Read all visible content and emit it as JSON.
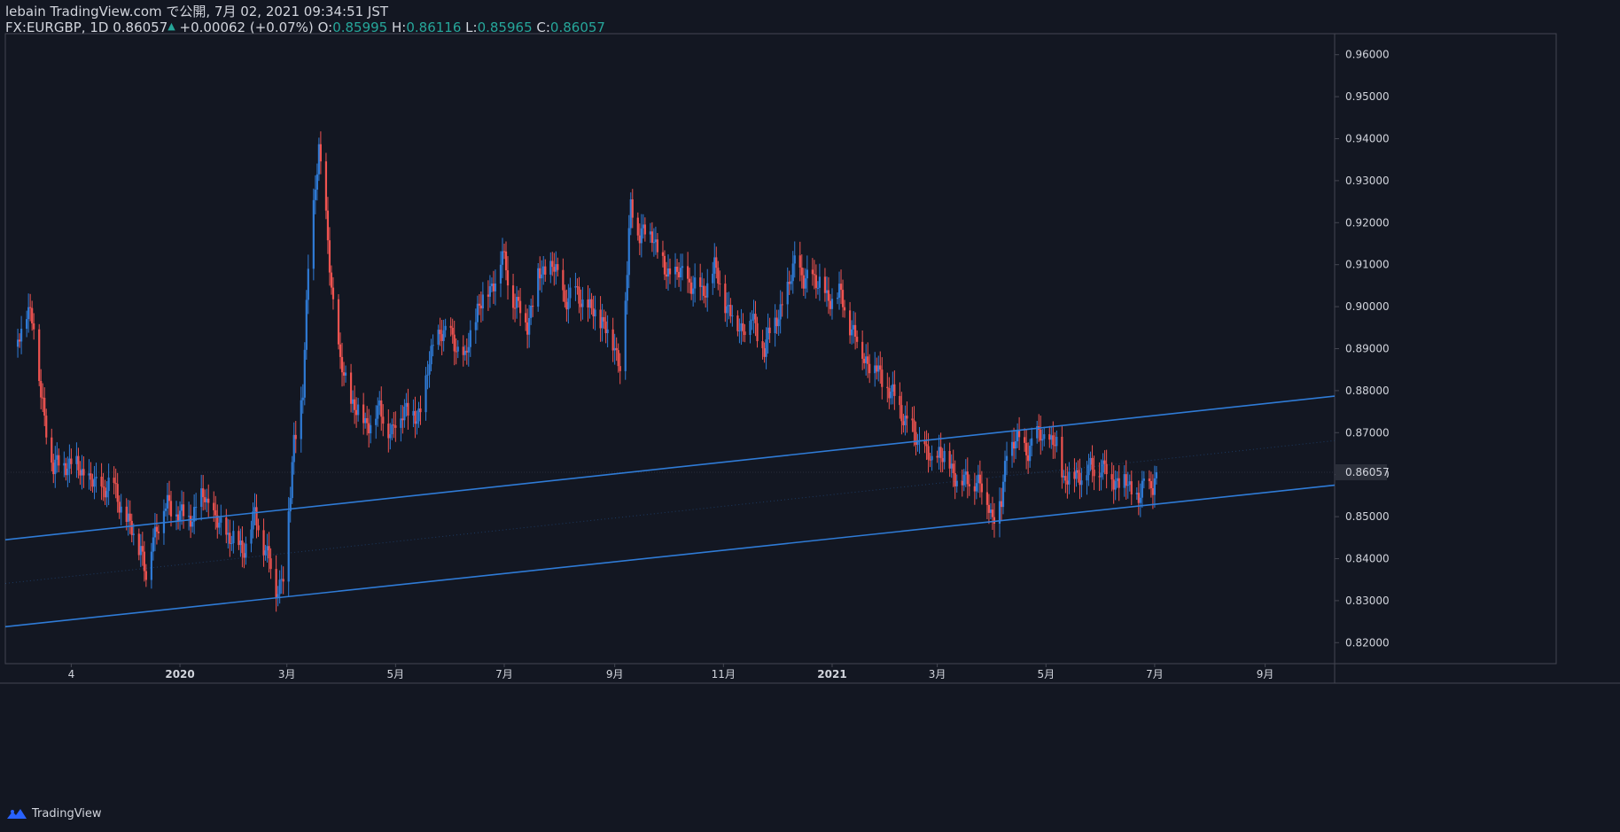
{
  "header": {
    "line1": "lebain TradingView.com で公開, 7月 02, 2021 09:34:51 JST",
    "symbol": "FX:EURGBP, 1D",
    "last": "0.86057",
    "up_arrow": "▲",
    "change": "+0.00062 (+0.07%)",
    "o_label": "O:",
    "o_val": "0.85995",
    "h_label": "H:",
    "h_val": "0.86116",
    "l_label": "L:",
    "l_val": "0.85965",
    "c_label": "C:",
    "c_val": "0.86057"
  },
  "footer": {
    "brand": "TradingView",
    "logo_icon": "tradingview-logo-icon"
  },
  "colors": {
    "up": "#2962ff",
    "up_candle": "#2f7bd6",
    "down": "#ef5350",
    "line": "#2f7bd6",
    "bg": "#131722",
    "grid": "#2a2e39"
  },
  "chart_data": {
    "type": "candlestick",
    "title": "FX:EURGBP, 1D",
    "ylim": [
      0.815,
      0.965
    ],
    "y_ticks": [
      "0.96000",
      "0.95000",
      "0.94000",
      "0.93000",
      "0.92000",
      "0.91000",
      "0.90000",
      "0.89000",
      "0.88000",
      "0.87000",
      "0.86000",
      "0.85000",
      "0.84000",
      "0.83000",
      "0.82000"
    ],
    "y_tick_values": [
      0.96,
      0.95,
      0.94,
      0.93,
      0.92,
      0.91,
      0.9,
      0.89,
      0.88,
      0.87,
      0.86,
      0.85,
      0.84,
      0.83,
      0.82
    ],
    "current_price_label": "0.86057",
    "current_price": 0.86057,
    "x_ticks": [
      {
        "label": "4",
        "date": "2019-11-01"
      },
      {
        "label": "2020",
        "date": "2020-01-01"
      },
      {
        "label": "3月",
        "date": "2020-03-01"
      },
      {
        "label": "5月",
        "date": "2020-05-01"
      },
      {
        "label": "7月",
        "date": "2020-07-01"
      },
      {
        "label": "9月",
        "date": "2020-09-01"
      },
      {
        "label": "11月",
        "date": "2020-11-01"
      },
      {
        "label": "2021",
        "date": "2021-01-01"
      },
      {
        "label": "3月",
        "date": "2021-03-01"
      },
      {
        "label": "5月",
        "date": "2021-05-01"
      },
      {
        "label": "7月",
        "date": "2021-07-01"
      },
      {
        "label": "9月",
        "date": "2021-09-01"
      }
    ],
    "price_path": [
      [
        "2019-10-01",
        0.89
      ],
      [
        "2019-10-08",
        0.9
      ],
      [
        "2019-10-11",
        0.897
      ],
      [
        "2019-10-15",
        0.878
      ],
      [
        "2019-10-22",
        0.862
      ],
      [
        "2019-11-01",
        0.863
      ],
      [
        "2019-11-15",
        0.857
      ],
      [
        "2019-11-25",
        0.857
      ],
      [
        "2019-12-03",
        0.848
      ],
      [
        "2019-12-10",
        0.843
      ],
      [
        "2019-12-13",
        0.835
      ],
      [
        "2019-12-17",
        0.846
      ],
      [
        "2019-12-25",
        0.853
      ],
      [
        "2020-01-05",
        0.849
      ],
      [
        "2020-01-15",
        0.855
      ],
      [
        "2020-01-22",
        0.848
      ],
      [
        "2020-01-30",
        0.845
      ],
      [
        "2020-02-05",
        0.842
      ],
      [
        "2020-02-12",
        0.85
      ],
      [
        "2020-02-20",
        0.84
      ],
      [
        "2020-02-24",
        0.832
      ],
      [
        "2020-02-28",
        0.837
      ],
      [
        "2020-03-03",
        0.855
      ],
      [
        "2020-03-05",
        0.868
      ],
      [
        "2020-03-10",
        0.88
      ],
      [
        "2020-03-13",
        0.908
      ],
      [
        "2020-03-17",
        0.93
      ],
      [
        "2020-03-19",
        0.938
      ],
      [
        "2020-03-23",
        0.92
      ],
      [
        "2020-03-26",
        0.905
      ],
      [
        "2020-03-31",
        0.886
      ],
      [
        "2020-04-06",
        0.878
      ],
      [
        "2020-04-14",
        0.872
      ],
      [
        "2020-04-22",
        0.875
      ],
      [
        "2020-04-29",
        0.87
      ],
      [
        "2020-05-07",
        0.877
      ],
      [
        "2020-05-13",
        0.872
      ],
      [
        "2020-05-19",
        0.885
      ],
      [
        "2020-05-26",
        0.895
      ],
      [
        "2020-06-02",
        0.892
      ],
      [
        "2020-06-09",
        0.887
      ],
      [
        "2020-06-16",
        0.9
      ],
      [
        "2020-06-23",
        0.904
      ],
      [
        "2020-06-30",
        0.912
      ],
      [
        "2020-07-06",
        0.902
      ],
      [
        "2020-07-14",
        0.896
      ],
      [
        "2020-07-20",
        0.907
      ],
      [
        "2020-07-28",
        0.91
      ],
      [
        "2020-08-04",
        0.902
      ],
      [
        "2020-08-11",
        0.903
      ],
      [
        "2020-08-18",
        0.899
      ],
      [
        "2020-08-25",
        0.897
      ],
      [
        "2020-09-01",
        0.89
      ],
      [
        "2020-09-04",
        0.887
      ],
      [
        "2020-09-08",
        0.907
      ],
      [
        "2020-09-10",
        0.925
      ],
      [
        "2020-09-15",
        0.917
      ],
      [
        "2020-09-22",
        0.918
      ],
      [
        "2020-09-29",
        0.908
      ],
      [
        "2020-10-06",
        0.908
      ],
      [
        "2020-10-13",
        0.906
      ],
      [
        "2020-10-20",
        0.903
      ],
      [
        "2020-10-27",
        0.909
      ],
      [
        "2020-11-03",
        0.9
      ],
      [
        "2020-11-10",
        0.895
      ],
      [
        "2020-11-17",
        0.897
      ],
      [
        "2020-11-24",
        0.89
      ],
      [
        "2020-12-01",
        0.898
      ],
      [
        "2020-12-07",
        0.903
      ],
      [
        "2020-12-11",
        0.912
      ],
      [
        "2020-12-16",
        0.905
      ],
      [
        "2020-12-21",
        0.908
      ],
      [
        "2020-12-29",
        0.902
      ],
      [
        "2021-01-05",
        0.903
      ],
      [
        "2021-01-12",
        0.895
      ],
      [
        "2021-01-19",
        0.888
      ],
      [
        "2021-01-26",
        0.885
      ],
      [
        "2021-02-02",
        0.88
      ],
      [
        "2021-02-09",
        0.875
      ],
      [
        "2021-02-15",
        0.87
      ],
      [
        "2021-02-22",
        0.866
      ],
      [
        "2021-02-26",
        0.862
      ],
      [
        "2021-03-02",
        0.866
      ],
      [
        "2021-03-09",
        0.861
      ],
      [
        "2021-03-16",
        0.858
      ],
      [
        "2021-03-23",
        0.859
      ],
      [
        "2021-03-30",
        0.853
      ],
      [
        "2021-04-01",
        0.85
      ],
      [
        "2021-04-06",
        0.853
      ],
      [
        "2021-04-09",
        0.866
      ],
      [
        "2021-04-14",
        0.868
      ],
      [
        "2021-04-21",
        0.866
      ],
      [
        "2021-04-28",
        0.87
      ],
      [
        "2021-05-04",
        0.867
      ],
      [
        "2021-05-07",
        0.867
      ],
      [
        "2021-05-11",
        0.859
      ],
      [
        "2021-05-18",
        0.86
      ],
      [
        "2021-05-25",
        0.861
      ],
      [
        "2021-06-01",
        0.862
      ],
      [
        "2021-06-08",
        0.859
      ],
      [
        "2021-06-15",
        0.858
      ],
      [
        "2021-06-22",
        0.854
      ],
      [
        "2021-06-25",
        0.857
      ],
      [
        "2021-06-30",
        0.858
      ],
      [
        "2021-07-02",
        0.8606
      ]
    ],
    "trendlines": [
      {
        "start": [
          "2019-09-25",
          0.8445
        ],
        "end": [
          "2021-10-10",
          0.8787
        ],
        "style": "solid"
      },
      {
        "start": [
          "2019-09-25",
          0.8238
        ],
        "end": [
          "2021-10-10",
          0.8575
        ],
        "style": "solid"
      },
      {
        "start": [
          "2019-09-25",
          0.8341
        ],
        "end": [
          "2021-10-10",
          0.8681
        ],
        "style": "dotted"
      }
    ]
  }
}
